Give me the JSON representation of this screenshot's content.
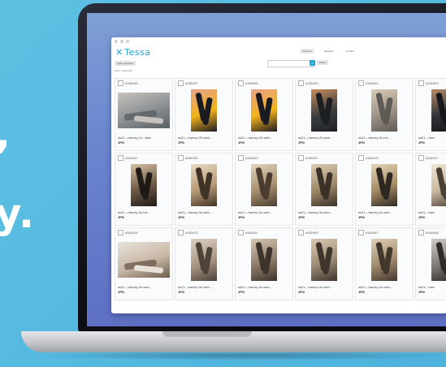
{
  "background": {
    "line1": ",",
    "line2": "y."
  },
  "app": {
    "logo": "Tessa",
    "logo_mark": "✕"
  },
  "nav": [
    {
      "label": "About us",
      "active": true
    },
    {
      "label": "Services",
      "active": false
    },
    {
      "label": "Contact",
      "active": false
    }
  ],
  "toolbar": {
    "action_label": "Apply selection",
    "search_placeholder": "",
    "filter_label": "Filters"
  },
  "breadcrumb": "Files  ›  Materials  ›",
  "cards": [
    {
      "id": "#182439",
      "name": "ss21---harvey-11---blai...",
      "type": "JPG",
      "kind": "land",
      "palette": [
        "#8a8f94",
        "#5a5f63",
        "#c7c2bb"
      ]
    },
    {
      "id": "#182437",
      "name": "ss21---harvey-29-web...",
      "type": "JPG",
      "kind": "port",
      "palette": [
        "#f2b21a",
        "#1a1a22",
        "#e7a38c"
      ]
    },
    {
      "id": "#182435",
      "name": "ss21---harvey-29-web...",
      "type": "JPG",
      "kind": "port",
      "palette": [
        "#f2b21a",
        "#1a1a22",
        "#e7a38c"
      ]
    },
    {
      "id": "#182433",
      "name": "ss21---harvey-29-web...",
      "type": "JPG",
      "kind": "port",
      "palette": [
        "#3b3f43",
        "#1d1e22",
        "#c98b5a"
      ]
    },
    {
      "id": "#182431",
      "name": "ss21---harvey-3x-hd-...",
      "type": "JPG",
      "kind": "port",
      "palette": [
        "#9d9286",
        "#5f5a55",
        "#d9cbb7"
      ]
    },
    {
      "id": "#182429",
      "name": "ss21---harv",
      "type": "JPG",
      "kind": "port",
      "palette": [
        "#2f3236",
        "#16171a",
        "#b98b6a"
      ]
    },
    {
      "id": "#182427",
      "name": "ss21---harvey-3x-hd-...",
      "type": "JPG",
      "kind": "port",
      "palette": [
        "#6d5844",
        "#1f1a16",
        "#d8c3a5"
      ]
    },
    {
      "id": "#182425",
      "name": "ss21---harvey-3x-web...",
      "type": "JPG",
      "kind": "port",
      "palette": [
        "#b89a76",
        "#3f3328",
        "#e8dcc6"
      ]
    },
    {
      "id": "#182423",
      "name": "ss21---harvey-3x-web...",
      "type": "JPG",
      "kind": "port",
      "palette": [
        "#a7906f",
        "#4a3d30",
        "#e2d4bd"
      ]
    },
    {
      "id": "#182421",
      "name": "ss21---harvey-3x-web...",
      "type": "JPG",
      "kind": "port",
      "palette": [
        "#9d8768",
        "#3a3129",
        "#e0cfb4"
      ]
    },
    {
      "id": "#182419",
      "name": "ss21---harvey-3x-web...",
      "type": "JPG",
      "kind": "port",
      "palette": [
        "#a58b63",
        "#2e2822",
        "#e6d6bb"
      ]
    },
    {
      "id": "#182417",
      "name": "ss21---harv",
      "type": "JPG",
      "kind": "port",
      "palette": [
        "#c9b79f",
        "#4a3f35",
        "#f0e6d6"
      ]
    },
    {
      "id": "#182415",
      "name": "ss21---harvey-3x-web...",
      "type": "JPG",
      "kind": "land",
      "palette": [
        "#c9b9a7",
        "#6d5e50",
        "#e8e2da"
      ]
    },
    {
      "id": "#182413",
      "name": "ss21---harvey-3x-web...",
      "type": "JPG",
      "kind": "port",
      "palette": [
        "#a89683",
        "#4e4339",
        "#ddd2c4"
      ]
    },
    {
      "id": "#182411",
      "name": "ss21---harvey-3x-web...",
      "type": "JPG",
      "kind": "port",
      "palette": [
        "#8d7b69",
        "#3c332b",
        "#d6c7b3"
      ]
    },
    {
      "id": "#182409",
      "name": "ss21---harvey-3x-web...",
      "type": "JPG",
      "kind": "port",
      "palette": [
        "#9c8a74",
        "#3e352d",
        "#dacab4"
      ]
    },
    {
      "id": "#182407",
      "name": "ss21---harvey-3x-web...",
      "type": "JPG",
      "kind": "port",
      "palette": [
        "#a08a6c",
        "#42372d",
        "#e2d2ba"
      ]
    },
    {
      "id": "#182405",
      "name": "ss21---harv",
      "type": "JPG",
      "kind": "port",
      "palette": [
        "#7d7a78",
        "#2f2c2a",
        "#d2ccc6"
      ]
    }
  ]
}
